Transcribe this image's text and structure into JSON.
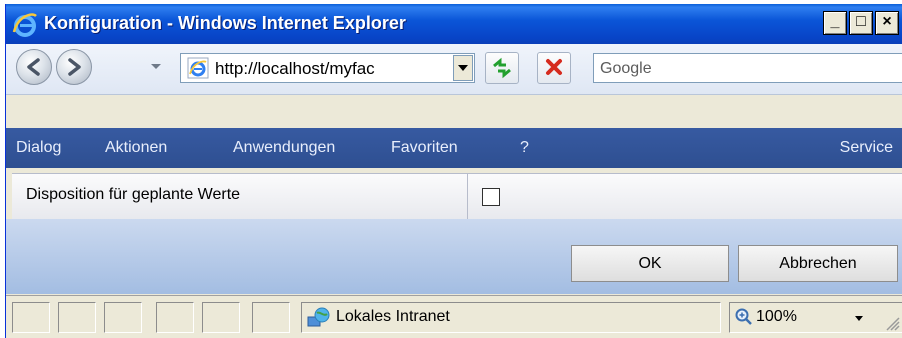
{
  "window": {
    "title": "Konfiguration - Windows Internet Explorer",
    "minimize_symbol": "_",
    "maximize_symbol": "□",
    "close_symbol": "×"
  },
  "addressbar": {
    "back_icon": "back-arrow-icon",
    "forward_icon": "forward-arrow-icon",
    "url": "http://localhost/myfac",
    "refresh_icon": "refresh-icon",
    "stop_icon": "stop-icon",
    "search_placeholder": "Google"
  },
  "menubar": {
    "items": [
      "Dialog",
      "Aktionen",
      "Anwendungen",
      "Favoriten",
      "?"
    ],
    "service": "Service"
  },
  "form": {
    "row_label": "Disposition für geplante Werte",
    "checkbox_checked": false
  },
  "buttons": {
    "ok": "OK",
    "cancel": "Abbrechen"
  },
  "statusbar": {
    "zone": "Lokales Intranet",
    "zone_icon": "intranet-globe-icon",
    "zoom": "100%",
    "zoom_icon": "magnifier-icon"
  },
  "colors": {
    "titlebar": "#0b56d8",
    "menubar": "#2e4f91",
    "buttonarea": "#a3bde2"
  }
}
